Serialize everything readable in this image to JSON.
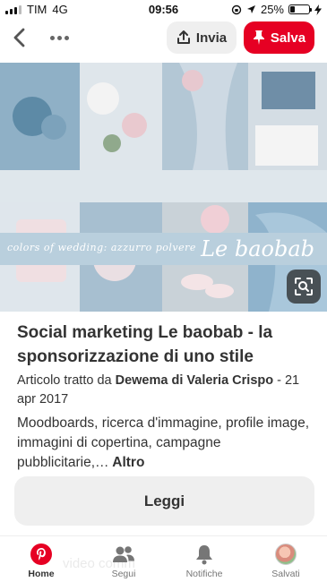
{
  "status_bar": {
    "carrier": "TIM",
    "network": "4G",
    "time": "09:56",
    "battery": "25%",
    "battery_level": 0.25
  },
  "top_bar": {
    "send_label": "Invia",
    "save_label": "Salva"
  },
  "image": {
    "script_text": "colors of wedding: azzurro polvere",
    "brand_text": "Le baobab"
  },
  "pin": {
    "title": "Social marketing Le baobab - la sponsorizzazione di uno stile",
    "source_prefix": "Articolo tratto da ",
    "source_author": "Dewema di Valeria Crispo",
    "source_date": " - 21 apr 2017",
    "description": "Moodboards, ricerca d'immagine, profile image, immagini di copertina, campagne pubblicitarie,…",
    "more_label": " Altro",
    "read_label": "Leggi"
  },
  "bottom_nav": {
    "ghost_text": "video   comm",
    "items": [
      {
        "label": "Home"
      },
      {
        "label": "Segui"
      },
      {
        "label": "Notifiche"
      },
      {
        "label": "Salvati"
      }
    ]
  },
  "colors": {
    "brand_red": "#e60023",
    "button_gray": "#efefef",
    "text": "#333333"
  }
}
